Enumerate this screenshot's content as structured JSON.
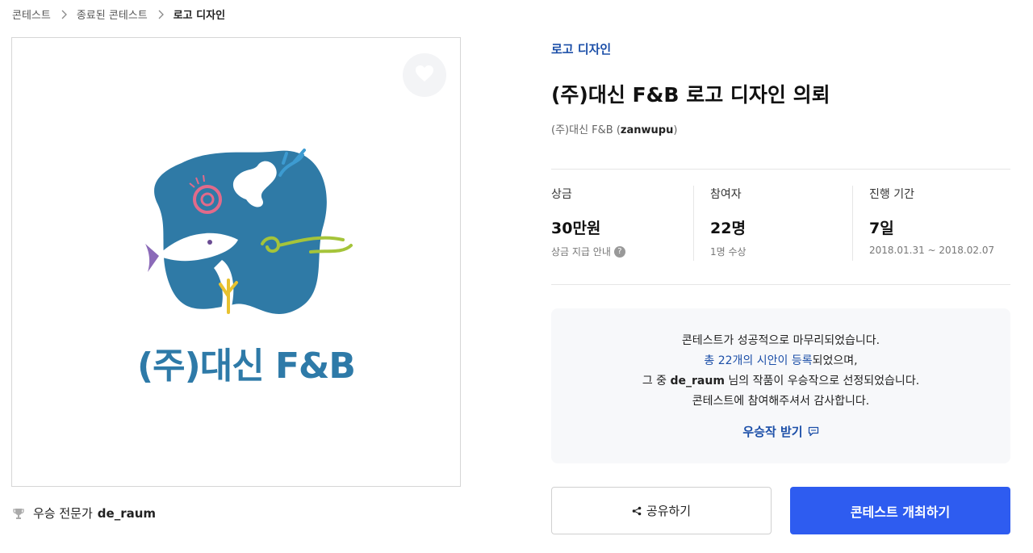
{
  "breadcrumb": [
    {
      "label": "콘테스트"
    },
    {
      "label": "종료된 콘테스트"
    },
    {
      "label": "로고 디자인"
    }
  ],
  "image": {
    "logo_text": "(주)대신 F&B",
    "favorite_icon": "heart-icon"
  },
  "winner": {
    "prefix": "우승 전문가",
    "name": "de_raum",
    "icon": "trophy-icon"
  },
  "contest": {
    "category": "로고 디자인",
    "title": "(주)대신 F&B 로고 디자인 의뢰",
    "owner_name": "(주)대신 F&B",
    "owner_open": "(",
    "owner_id": "zanwupu",
    "owner_close": ")"
  },
  "stats": {
    "prize": {
      "label": "상금",
      "value": "30만원",
      "sub": "상금 지급 안내",
      "help_icon": "?"
    },
    "participants": {
      "label": "참여자",
      "value": "22명",
      "sub": "1명 수상"
    },
    "duration": {
      "label": "진행 기간",
      "value": "7일",
      "sub": "2018.01.31 ~ 2018.02.07"
    }
  },
  "notice": {
    "line1": "콘테스트가 성공적으로 마무리되었습니다.",
    "line2_link": "총 22개의 시안이 등록",
    "line2_rest": "되었으며,",
    "line3_a": "그 중 ",
    "line3_name": "de_raum",
    "line3_b": " 님의 작품이 우승작으로 선정되었습니다.",
    "line4": "콘테스트에 참여해주셔서 감사합니다.",
    "get_label": "우승작 받기"
  },
  "actions": {
    "share_label": "공유하기",
    "host_label": "콘테스트 개최하기"
  },
  "colors": {
    "accent_blue": "#2e5cf0",
    "link_blue": "#1c4fa8",
    "logo_blue": "#2e7aa8"
  }
}
